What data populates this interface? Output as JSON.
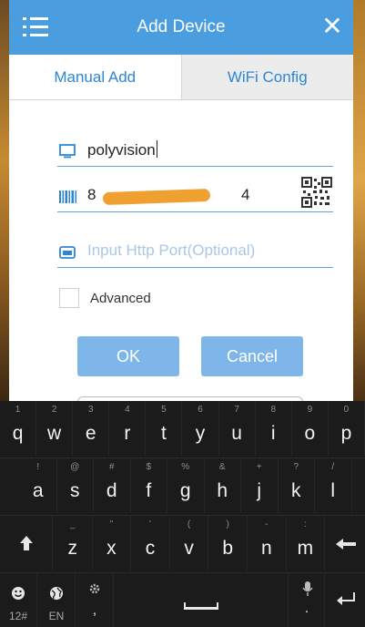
{
  "header": {
    "title": "Add Device"
  },
  "tabs": [
    {
      "label": "Manual Add",
      "active": true
    },
    {
      "label": "WiFi Config",
      "active": false
    }
  ],
  "form": {
    "name_value": "polyvision",
    "serial_value_visible": "8",
    "serial_tail": "4",
    "port_placeholder": "Input Http Port(Optional)",
    "advanced_label": "Advanced",
    "advanced_checked": false
  },
  "buttons": {
    "ok": "OK",
    "cancel": "Cancel"
  },
  "keyboard": {
    "row1": [
      {
        "k": "q",
        "h": "1"
      },
      {
        "k": "w",
        "h": "2"
      },
      {
        "k": "e",
        "h": "3"
      },
      {
        "k": "r",
        "h": "4"
      },
      {
        "k": "t",
        "h": "5"
      },
      {
        "k": "y",
        "h": "6"
      },
      {
        "k": "u",
        "h": "7"
      },
      {
        "k": "i",
        "h": "8"
      },
      {
        "k": "o",
        "h": "9"
      },
      {
        "k": "p",
        "h": "0"
      }
    ],
    "row2": [
      {
        "k": "a",
        "h": "!"
      },
      {
        "k": "s",
        "h": "@"
      },
      {
        "k": "d",
        "h": "#"
      },
      {
        "k": "f",
        "h": "$"
      },
      {
        "k": "g",
        "h": "%"
      },
      {
        "k": "h",
        "h": "&"
      },
      {
        "k": "j",
        "h": "+"
      },
      {
        "k": "k",
        "h": "?"
      },
      {
        "k": "l",
        "h": "/"
      }
    ],
    "row3": [
      {
        "k": "z",
        "h": "_"
      },
      {
        "k": "x",
        "h": "\""
      },
      {
        "k": "c",
        "h": "'"
      },
      {
        "k": "v",
        "h": "("
      },
      {
        "k": "b",
        "h": ")"
      },
      {
        "k": "n",
        "h": "-"
      },
      {
        "k": "m",
        "h": ":"
      }
    ],
    "bottom": {
      "sym": "12#",
      "lang": "EN",
      "comma": ",",
      "period": "."
    }
  },
  "colors": {
    "accent": "#4a9ee0",
    "tab_text": "#2e86d6",
    "button": "#7fb6ea",
    "underline": "#5ea4e6"
  },
  "icons": {
    "menu": "menu-icon",
    "close": "close-icon",
    "device": "monitor-icon",
    "serial": "barcode-icon",
    "qr": "qr-code-icon",
    "port": "port-icon"
  }
}
